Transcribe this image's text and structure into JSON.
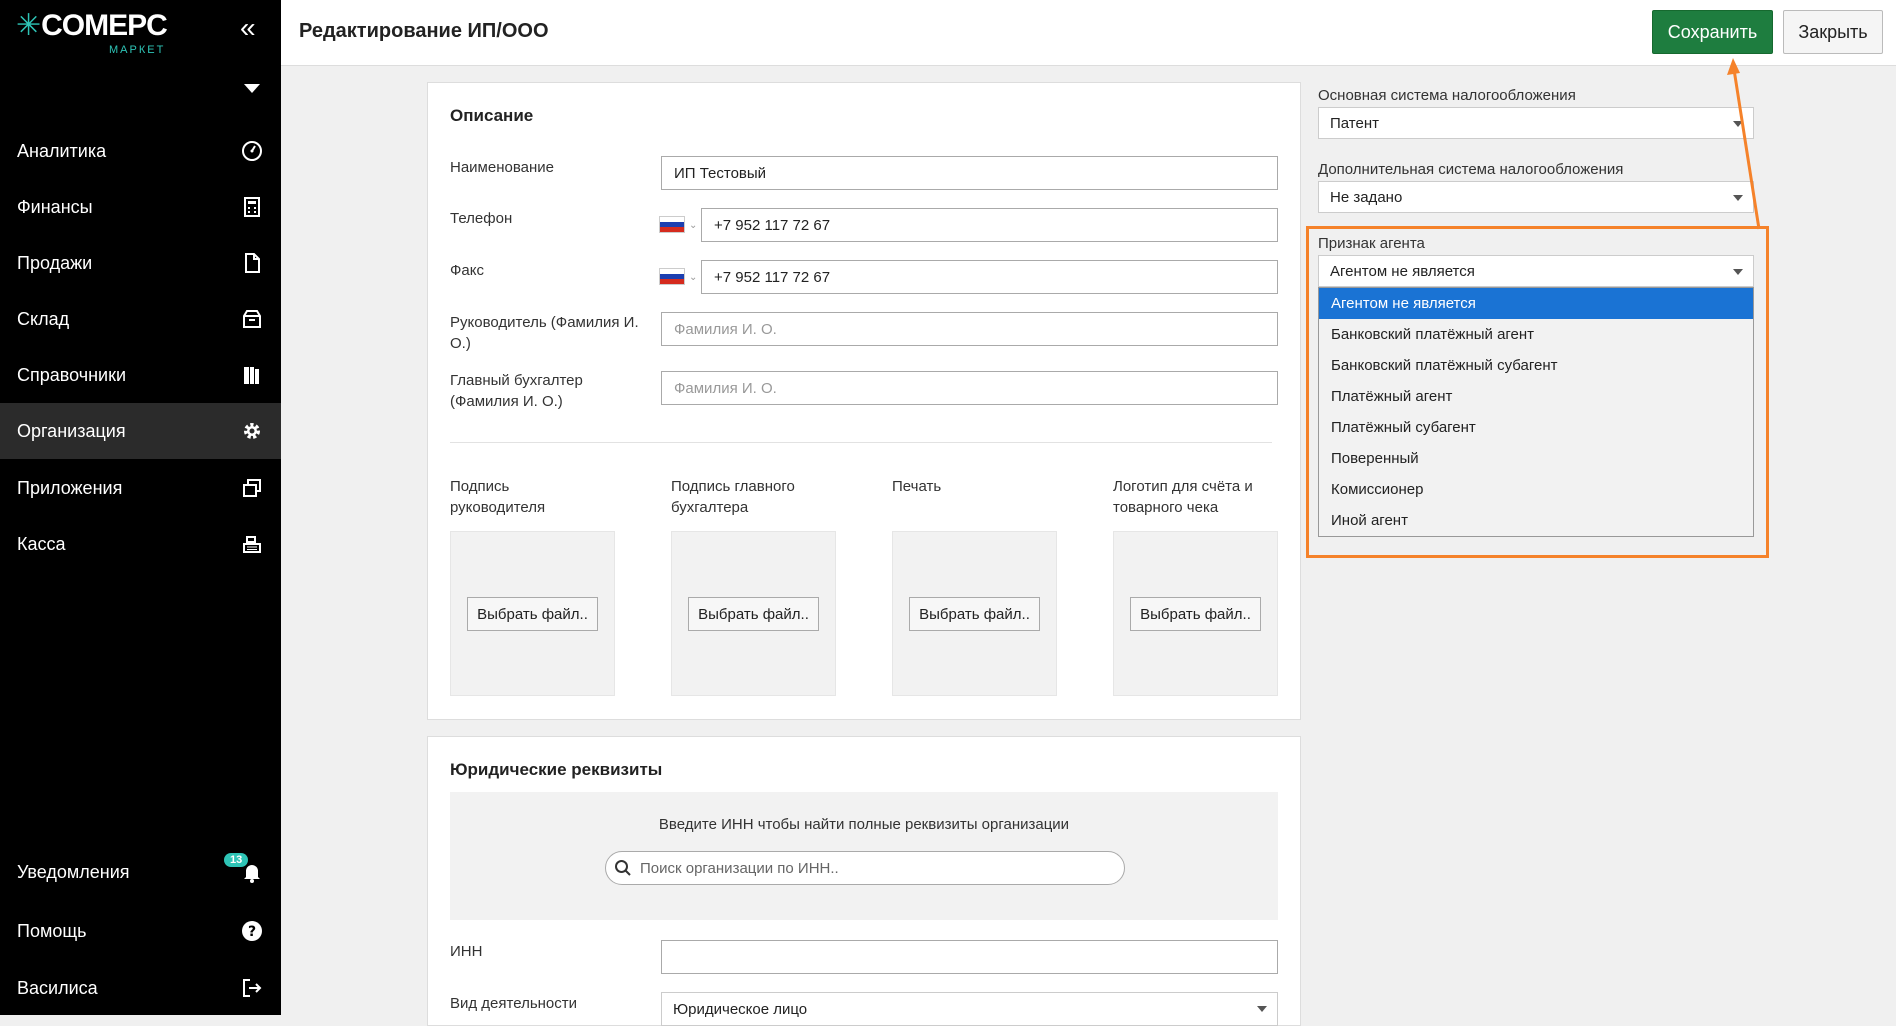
{
  "app": {
    "logo_main": "COMEPC",
    "logo_sub": "МАРКЕТ",
    "collapse_icon": "«"
  },
  "sidebar": {
    "items": [
      {
        "label": "Аналитика",
        "icon": "dashboard-icon"
      },
      {
        "label": "Финансы",
        "icon": "calculator-icon"
      },
      {
        "label": "Продажи",
        "icon": "document-icon"
      },
      {
        "label": "Склад",
        "icon": "box-icon"
      },
      {
        "label": "Справочники",
        "icon": "books-icon"
      },
      {
        "label": "Организация",
        "icon": "gear-icon",
        "active": true
      },
      {
        "label": "Приложения",
        "icon": "windows-icon"
      },
      {
        "label": "Касса",
        "icon": "cash-register-icon"
      }
    ],
    "bottom": [
      {
        "label": "Уведомления",
        "icon": "bell-icon",
        "badge": "13"
      },
      {
        "label": "Помощь",
        "icon": "help-icon"
      },
      {
        "label": "Василиса",
        "icon": "logout-icon"
      }
    ]
  },
  "header": {
    "title": "Редактирование ИП/ООО",
    "save": "Сохранить",
    "close": "Закрыть"
  },
  "description": {
    "title": "Описание",
    "name_label": "Наименование",
    "name_value": "ИП Тестовый",
    "phone_label": "Телефон",
    "phone_value": "+7 952 117 72 67",
    "fax_label": "Факс",
    "fax_value": "+7 952 117 72 67",
    "director_label": "Руководитель (Фамилия И. О.)",
    "director_placeholder": "Фамилия И. О.",
    "accountant_label": "Главный бухгалтер (Фамилия И. О.)",
    "accountant_placeholder": "Фамилия И. О.",
    "uploads": [
      {
        "label": "Подпись руководителя",
        "button": "Выбрать файл.."
      },
      {
        "label": "Подпись главного бухгалтера",
        "button": "Выбрать файл.."
      },
      {
        "label": "Печать",
        "button": "Выбрать файл.."
      },
      {
        "label": "Логотип для счёта и товарного чека",
        "button": "Выбрать файл.."
      }
    ]
  },
  "legal": {
    "title": "Юридические реквизиты",
    "hint": "Введите ИНН чтобы найти полные реквизиты организации",
    "search_placeholder": "Поиск организации по ИНН..",
    "inn_label": "ИНН",
    "inn_value": "",
    "activity_label": "Вид деятельности",
    "activity_value": "Юридическое лицо"
  },
  "taxes": {
    "main_label": "Основная система налогообложения",
    "main_value": "Патент",
    "extra_label": "Дополнительная система налогообложения",
    "extra_value": "Не задано",
    "agent_label": "Признак агента",
    "agent_value": "Агентом не является",
    "agent_options": [
      "Агентом не является",
      "Банковский платёжный агент",
      "Банковский платёжный субагент",
      "Платёжный агент",
      "Платёжный субагент",
      "Поверенный",
      "Комиссионер",
      "Иной агент"
    ],
    "agent_selected_index": 0
  },
  "colors": {
    "accent": "#2ec4b6",
    "save": "#1e7d3f",
    "highlight": "#f5822a",
    "selected": "#1a73d4"
  }
}
